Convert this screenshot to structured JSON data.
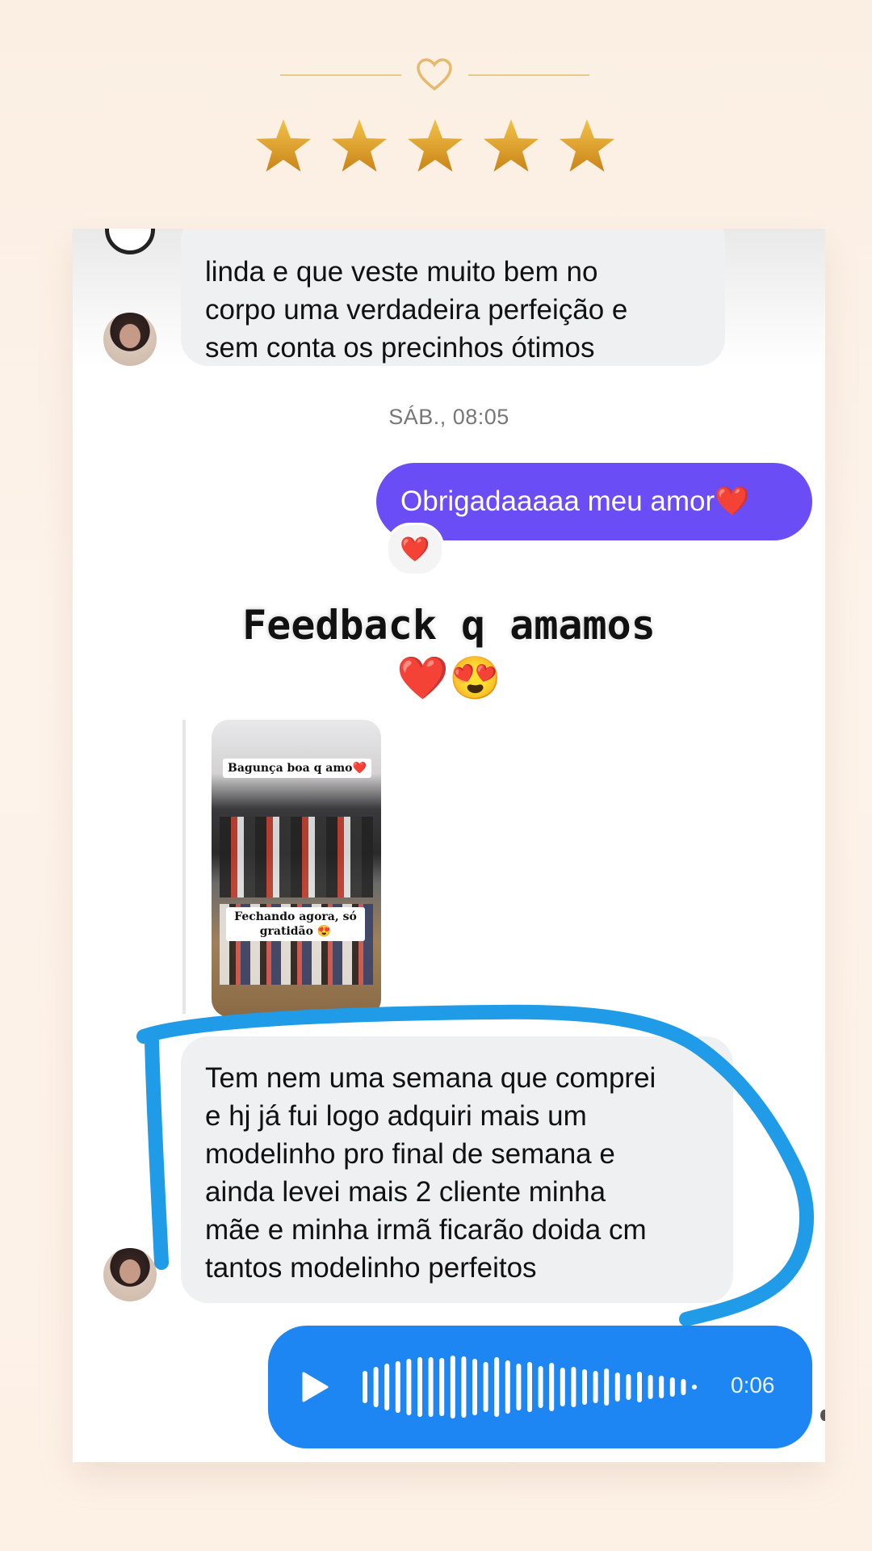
{
  "decoration": {
    "heart_icon": "heart-outline-icon",
    "star_icon": "star-icon",
    "star_count": 5,
    "accent_color": "#e9c98a",
    "star_color": "#e2a52a"
  },
  "chat": {
    "messages": [
      {
        "type": "incoming",
        "lines": [
          "linda e que veste muito bem no",
          "corpo uma verdadeira perfeição e",
          "sem conta os precinhos ótimos"
        ]
      },
      {
        "type": "timestamp",
        "text": "SÁB., 08:05"
      },
      {
        "type": "outgoing",
        "text": "Obrigadaaaaa meu amor❤️",
        "reaction": "❤️",
        "color": "#6b4df5"
      },
      {
        "type": "story_reply",
        "overlay_title": "Feedback q amamos",
        "overlay_emojis": "❤️😍",
        "caption_top": "Bagunça boa q amo❤️",
        "caption_bottom": "Fechando agora, só gratidão 😍"
      },
      {
        "type": "incoming",
        "lines": [
          "Tem nem uma semana que comprei",
          "e hj já fui logo adquiri mais um",
          "modelinho pro final de semana e",
          "ainda levei mais 2 cliente minha",
          "mãe e minha irmã ficarão doida cm",
          "tantos modelinho perfeitos"
        ],
        "highlighted": true,
        "highlight_color": "#1f9be8"
      },
      {
        "type": "voice",
        "duration": "0:06",
        "color": "#1d86f2",
        "play_icon": "play-icon"
      }
    ]
  }
}
